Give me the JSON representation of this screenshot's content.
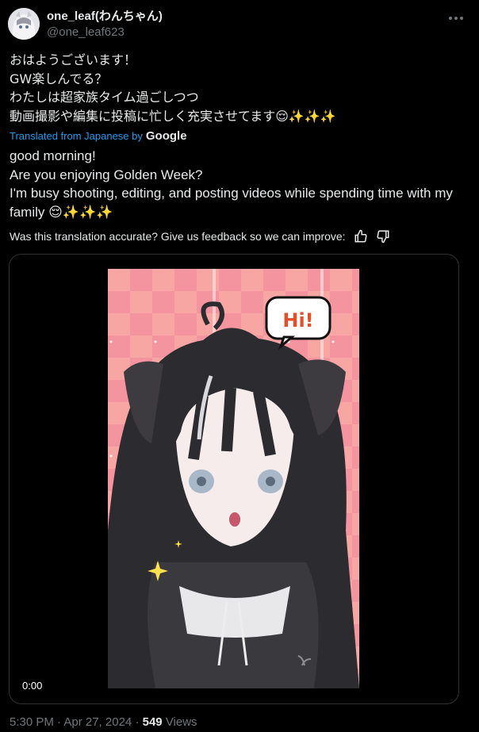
{
  "author": {
    "display_name": "one_leaf(わんちゃん)",
    "handle": "@one_leaf623"
  },
  "tweet": {
    "original_text": "おはようございます！\nGW楽しんでる？\nわたしは超家族タイム過ごしつつ\n動画撮影や編集に投稿に忙しく充実させてます😌✨✨✨",
    "translated_from": "Translated from Japanese by",
    "translator": "Google",
    "translated_text": "good morning!\nAre you enjoying Golden Week?\nI'm busy shooting, editing, and posting videos while spending time with my family 😌✨✨✨",
    "feedback_prompt": "Was this translation accurate? Give us feedback so we can improve:"
  },
  "media": {
    "video_time": "0:00",
    "speech_bubble": "Hi!"
  },
  "meta": {
    "timestamp": "5:30 PM · Apr 27, 2024",
    "separator": "·",
    "views_count": "549",
    "views_label": "Views"
  },
  "colors": {
    "accent": "#1d9bf0",
    "muted": "#71767b",
    "text": "#e7e9ea"
  }
}
